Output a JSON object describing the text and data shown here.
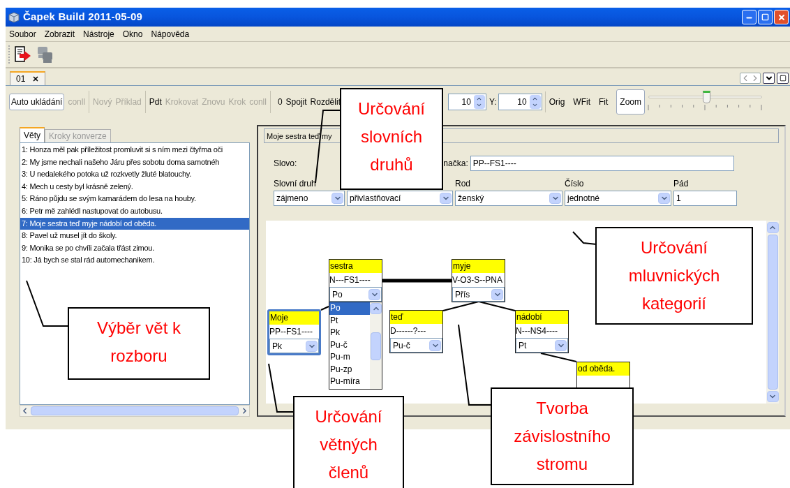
{
  "window": {
    "title": "Čapek Build 2011-05-09"
  },
  "menu": [
    "Soubor",
    "Zobrazit",
    "Nástroje",
    "Okno",
    "Nápověda"
  ],
  "document_tabs": [
    {
      "label": "01",
      "selected": true
    }
  ],
  "toolbar": {
    "groups": [
      [
        {
          "kind": "button",
          "label": "Auto ukládání",
          "disabled": false
        },
        {
          "kind": "text",
          "label": "conll",
          "disabled": true
        }
      ],
      [
        {
          "kind": "text",
          "label": "Nový",
          "disabled": true
        },
        {
          "kind": "text",
          "label": "Příklad",
          "disabled": true
        }
      ],
      [
        {
          "kind": "text",
          "label": "Pdt",
          "disabled": false
        },
        {
          "kind": "text",
          "label": "Krokovat",
          "disabled": true
        },
        {
          "kind": "text",
          "label": "Znovu",
          "disabled": true
        },
        {
          "kind": "text",
          "label": "Krok",
          "disabled": true
        },
        {
          "kind": "text",
          "label": "conll",
          "disabled": true
        }
      ],
      [
        {
          "kind": "text",
          "label": "0",
          "disabled": false
        },
        {
          "kind": "text",
          "label": "Spojit",
          "disabled": false
        },
        {
          "kind": "text",
          "label": "Rozdělit",
          "disabled": false
        }
      ]
    ],
    "x_spinner": {
      "value": "10"
    },
    "y_spinner": {
      "label": "Y:",
      "value": "10"
    },
    "view_buttons": [
      {
        "label": "Orig",
        "selected": false
      },
      {
        "label": "WFit",
        "selected": false
      },
      {
        "label": "Fit",
        "selected": false
      },
      {
        "label": "Zoom",
        "selected": true
      }
    ],
    "zoom_slider": {
      "level": 0.51
    }
  },
  "sentence_panel": {
    "tabs": [
      {
        "label": "Věty",
        "selected": true
      },
      {
        "label": "Kroky konverze",
        "selected": false
      }
    ],
    "sentences": [
      {
        "text": "1: Honza měl pak příležitost promluvit si s ním mezi čtyřma oči",
        "selected": false
      },
      {
        "text": "2: My jsme nechali našeho Járu přes sobotu doma samotnéh",
        "selected": false
      },
      {
        "text": "3: U nedalekého potoka už rozkvetly žluté blatouchy.",
        "selected": false
      },
      {
        "text": "4: Mech u cesty byl krásně zelený.",
        "selected": false
      },
      {
        "text": "5: Ráno půjdu se svým kamarádem do lesa na houby.",
        "selected": false
      },
      {
        "text": "6: Petr mě zahlédl nastupovat do autobusu.",
        "selected": false
      },
      {
        "text": "7: Moje sestra teď myje nádobí od oběda.",
        "selected": true
      },
      {
        "text": "8: Pavel už musel jít do školy.",
        "selected": false
      },
      {
        "text": "9: Monika se po chvíli začala třást zimou.",
        "selected": false
      },
      {
        "text": "10: Já bych se stal rád automechanikem.",
        "selected": false
      }
    ]
  },
  "word_form": {
    "header": "Moje sestra teď my",
    "word_label": "Slovo:",
    "tag_label": "načka:",
    "tag_value": "PP--FS1----",
    "fields": [
      {
        "kind": "select",
        "label": "Slovní druh",
        "value": "zájmeno"
      },
      {
        "kind": "select",
        "value": "přivlastňovací"
      },
      {
        "kind": "select",
        "label": "Rod",
        "value": "ženský"
      },
      {
        "kind": "select",
        "label": "Číslo",
        "value": "jednotné"
      },
      {
        "kind": "input",
        "label": "Pád",
        "value": "1"
      }
    ]
  },
  "tree": {
    "nodes": [
      {
        "word": "sestra",
        "tag": "N---FS1----",
        "function": "Po",
        "selected": false
      },
      {
        "word": "myje",
        "tag": "V-O3-S--PNA",
        "function": "Přís",
        "selected": false
      },
      {
        "word": "Moje",
        "tag": "PP--FS1----",
        "function": "Pk",
        "selected": true
      },
      {
        "word": "teď",
        "tag": "D------?---",
        "function": "Pu-č",
        "selected": false
      },
      {
        "word": "nádobí",
        "tag": "N---NS4----",
        "function": "Pt",
        "selected": false
      },
      {
        "word": "od oběda.",
        "selected": false
      }
    ],
    "open_dropdown": [
      {
        "label": "Po",
        "selected": true
      },
      {
        "label": "Pt",
        "selected": false
      },
      {
        "label": "Pk",
        "selected": false
      },
      {
        "label": "Pu-č",
        "selected": false
      },
      {
        "label": "Pu-m",
        "selected": false
      },
      {
        "label": "Pu-zp",
        "selected": false
      },
      {
        "label": "Pu-míra",
        "selected": false
      }
    ]
  },
  "annotations": [
    "Určování slovních druhů",
    "Určování mluvnických kategorií",
    "Výběr vět k rozboru",
    "Určování větných členů",
    "Tvorba závislostního stromu"
  ]
}
